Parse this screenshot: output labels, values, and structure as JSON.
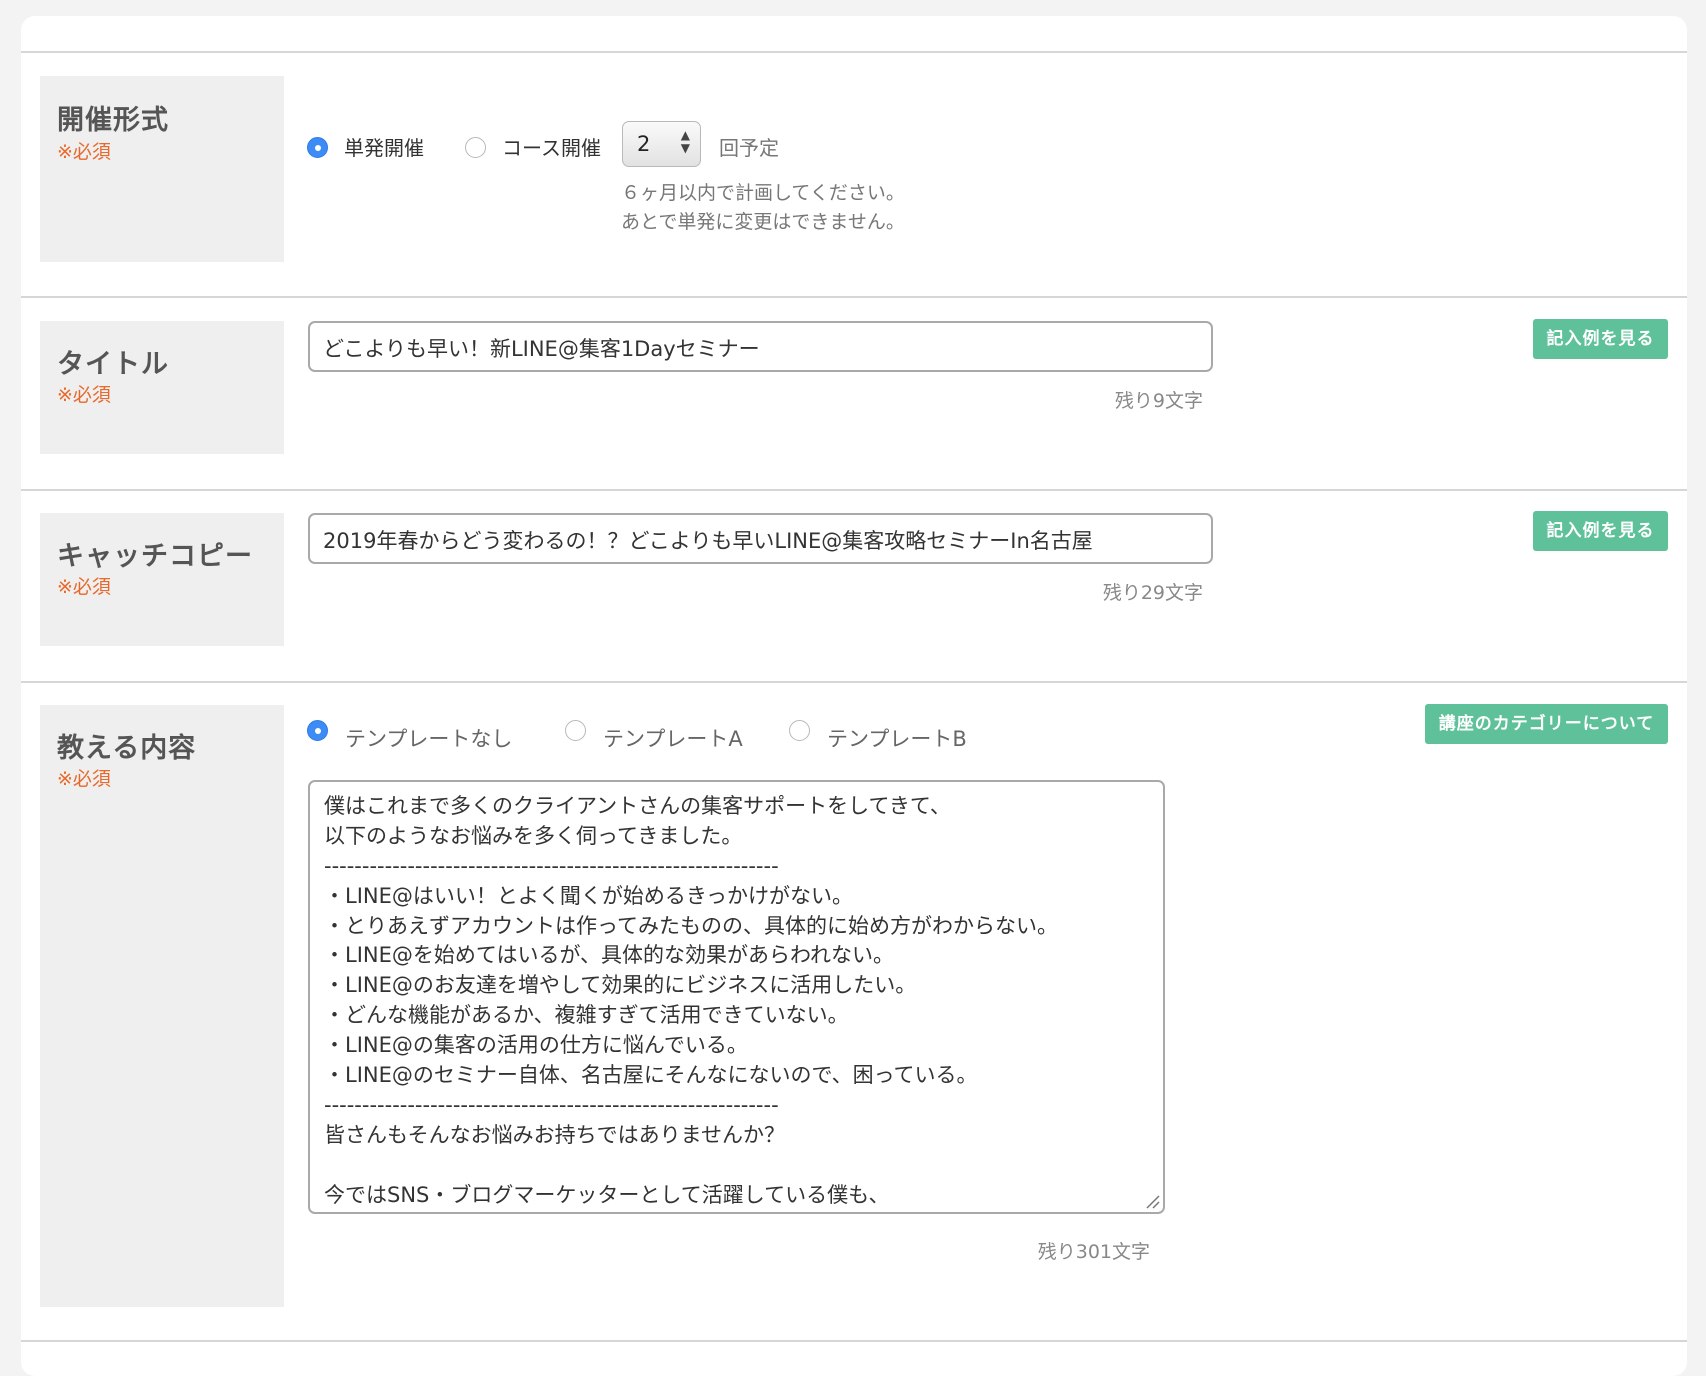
{
  "sections": {
    "format": {
      "label": "開催形式",
      "required": "※必須",
      "options": [
        {
          "label": "単発開催",
          "selected": true
        },
        {
          "label": "コース開催",
          "selected": false
        }
      ],
      "count_value": "2",
      "count_suffix": "回予定",
      "note_lines": [
        "６ヶ月以内で計画してください。",
        "あとで単発に変更はできません。"
      ]
    },
    "title": {
      "label": "タイトル",
      "required": "※必須",
      "value": "どこよりも早い！新LINE@集客1Dayセミナー",
      "counter": "残り9文字",
      "example_button": "記入例を見る"
    },
    "catchcopy": {
      "label": "キャッチコピー",
      "required": "※必須",
      "value": "2019年春からどう変わるの！？どこよりも早いLINE@集客攻略セミナーIn名古屋",
      "counter": "残り29文字",
      "example_button": "記入例を見る"
    },
    "content": {
      "label": "教える内容",
      "required": "※必須",
      "templates": [
        {
          "label": "テンプレートなし",
          "selected": true
        },
        {
          "label": "テンプレートA",
          "selected": false
        },
        {
          "label": "テンプレートB",
          "selected": false
        }
      ],
      "category_button": "講座のカテゴリーについて",
      "text_lines": [
        "僕はこれまで多くのクライアントさんの集客サポートをしてきて、",
        "以下のようなお悩みを多く伺ってきました。",
        "------------------------------------------------------------",
        "・LINE@はいい！とよく聞くが始めるきっかけがない。",
        "・とりあえずアカウントは作ってみたものの、具体的に始め方がわからない。",
        "・LINE@を始めてはいるが、具体的な効果があらわれない。",
        "・LINE@のお友達を増やして効果的にビジネスに活用したい。",
        "・どんな機能があるか、複雑すぎて活用できていない。",
        "・LINE@の集客の活用の仕方に悩んでいる。",
        "・LINE@のセミナー自体、名古屋にそんなにないので、困っている。",
        "------------------------------------------------------------",
        "皆さんもそんなお悩みお持ちではありませんか？",
        "",
        "今ではSNS・ブログマーケッターとして活躍している僕も、"
      ],
      "counter": "残り301文字"
    }
  },
  "colors": {
    "accent_blue": "#3d8bf5",
    "required_orange": "#e8692c",
    "button_green": "#5ec19a",
    "label_bg": "#efefef"
  }
}
